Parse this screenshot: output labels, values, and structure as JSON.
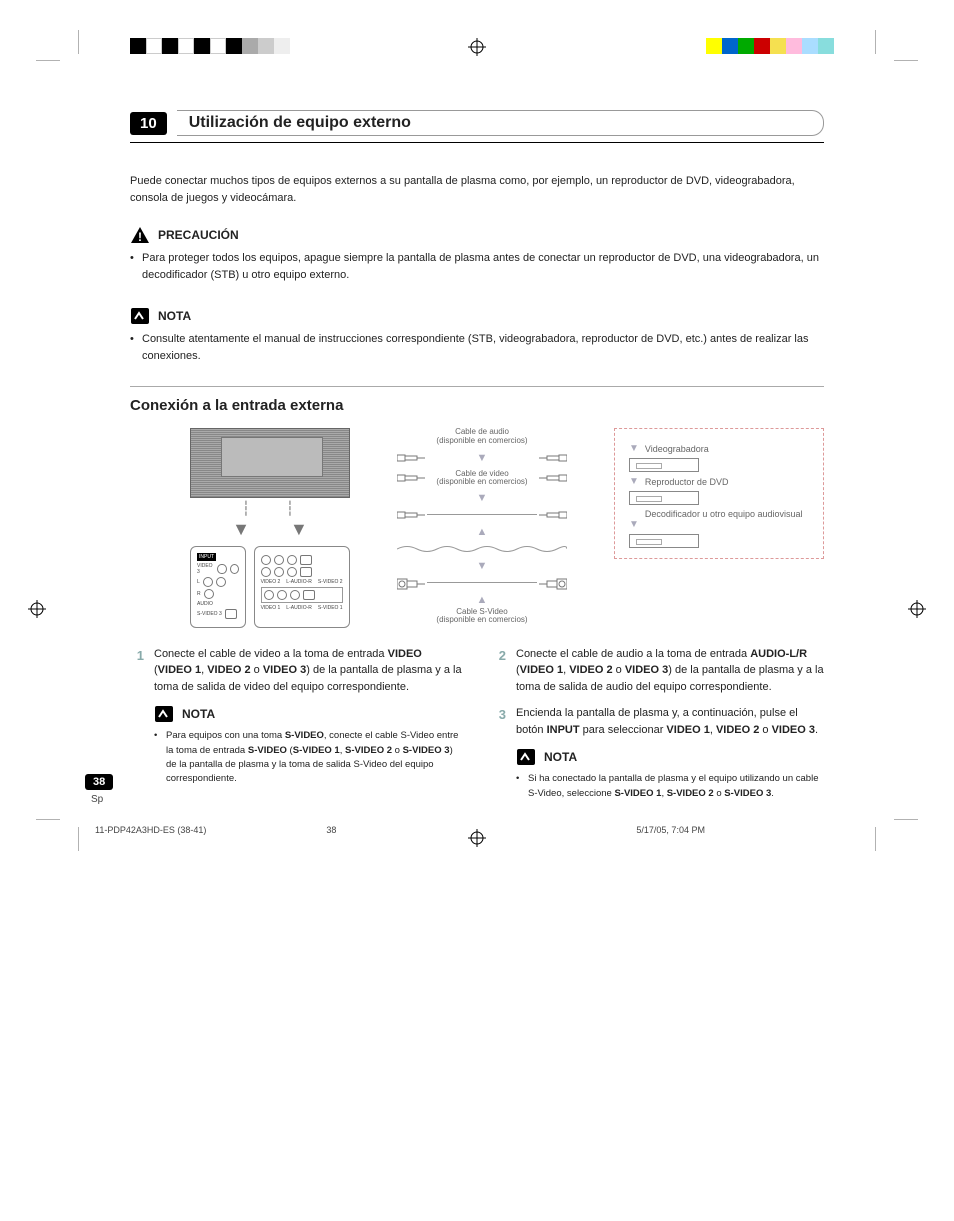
{
  "chapter": {
    "number": "10",
    "title": "Utilización de equipo externo"
  },
  "intro": "Puede conectar muchos tipos de equipos externos a su pantalla de plasma como, por ejemplo, un reproductor de DVD, videograbadora, consola de juegos y videocámara.",
  "precaucion": {
    "label": "PRECAUCIÓN",
    "bullet1": "Para proteger todos los equipos, apague siempre la pantalla de plasma antes de conectar un reproductor de DVD, una videograbadora, un decodificador (STB) u otro equipo externo."
  },
  "nota1": {
    "label": "NOTA",
    "bullet1": "Consulte atentamente el manual de instrucciones correspondiente (STB, videograbadora, reproductor de DVD, etc.) antes de realizar las conexiones."
  },
  "section2": {
    "title": "Conexión a la entrada externa"
  },
  "panel_labels": {
    "input": "INPUT",
    "video3": "VIDEO 3",
    "l": "L",
    "r": "R",
    "audio": "AUDIO",
    "svideo3": "S-VIDEO 3",
    "video2": "VIDEO 2",
    "l_audio_r": "L-AUDIO-R",
    "svideo2": "S-VIDEO 2",
    "video1": "VIDEO 1",
    "svideo1": "S-VIDEO 1"
  },
  "cables": {
    "audio_cap": "Cable de audio",
    "avail": "(disponible en comercios)",
    "video_cap": "Cable de video",
    "svideo_cap": "Cable S-Video"
  },
  "devices": {
    "vcr": "Videograbadora",
    "dvd": "Reproductor de DVD",
    "stb": "Decodificador u otro equipo audiovisual"
  },
  "steps": {
    "s1a": "Conecte el cable de video a la toma de entrada ",
    "s1b": "VIDEO",
    "s1c": " (",
    "s1d": "VIDEO 1",
    "s1e": ", ",
    "s1f": "VIDEO 2",
    "s1g": " o ",
    "s1h": "VIDEO 3",
    "s1i": ") de la pantalla de plasma y a la toma de salida de video del equipo correspondiente.",
    "note2_label": "NOTA",
    "n2a": "Para equipos con una toma ",
    "n2b": "S-VIDEO",
    "n2c": ", conecte el cable S-Video entre la toma de entrada ",
    "n2d": "S-VIDEO",
    "n2e": " (",
    "n2f": "S-VIDEO 1",
    "n2g": ", ",
    "n2h": "S-VIDEO 2",
    "n2i": " o ",
    "n2j": "S-VIDEO 3",
    "n2k": ") de la pantalla de plasma y la toma de salida S-Video del equipo correspondiente.",
    "s2a": "Conecte el cable de audio a la toma de entrada ",
    "s2b": "AUDIO-L/R",
    "s2c": " (",
    "s2d": "VIDEO 1",
    "s2e": ", ",
    "s2f": "VIDEO 2",
    "s2g": " o ",
    "s2h": "VIDEO 3",
    "s2i": ") de la pantalla de plasma y a la toma de salida de audio del equipo correspondiente.",
    "s3a": "Encienda la pantalla de plasma y, a continuación, pulse el botón ",
    "s3b": "INPUT",
    "s3c": " para seleccionar ",
    "s3d": "VIDEO 1",
    "s3e": ", ",
    "s3f": "VIDEO 2",
    "s3g": " o ",
    "s3h": "VIDEO 3",
    "s3i": ".",
    "note3_label": "NOTA",
    "n3a": "Si ha conectado la pantalla de plasma y el equipo utilizando un cable S-Video, seleccione ",
    "n3b": "S-VIDEO 1",
    "n3c": ", ",
    "n3d": "S-VIDEO 2",
    "n3e": " o ",
    "n3f": "S-VIDEO 3",
    "n3g": "."
  },
  "footer": {
    "page_num": "38",
    "lang": "Sp",
    "slug_file": "11-PDP42A3HD-ES (38-41)",
    "slug_page": "38",
    "slug_time": "5/17/05, 7:04 PM"
  },
  "colors": {
    "bars_left": [
      "#000",
      "#fff",
      "#000",
      "#fff",
      "#000",
      "#fff",
      "#000",
      "#fff",
      "#000",
      "#aaa",
      "#ccc",
      "#eee"
    ],
    "bars_right": [
      "#0ff",
      "#f0f",
      "#ff0",
      "#000",
      "#00a",
      "#0a0",
      "#a00",
      "#fd0",
      "#fcf",
      "#adf",
      "#8dd",
      "#fff"
    ]
  }
}
